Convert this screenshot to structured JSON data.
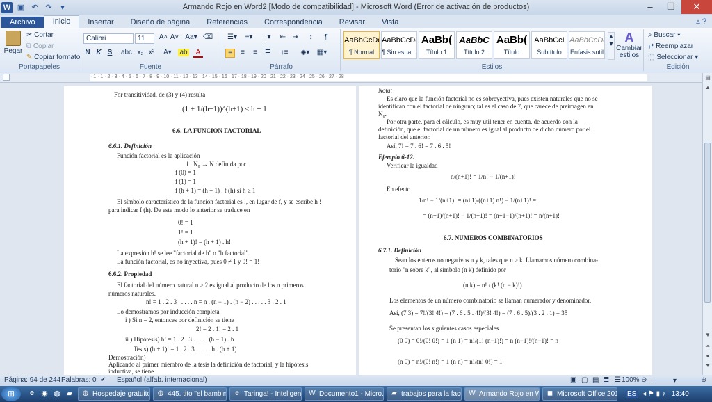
{
  "window": {
    "title": "Armando Rojo en Word2 [Modo de compatibilidad] - Microsoft Word (Error de activación de productos)"
  },
  "qat": {
    "undo": "↶",
    "redo": "↷",
    "logo": "W"
  },
  "tabs": [
    {
      "label": "Archivo"
    },
    {
      "label": "Inicio"
    },
    {
      "label": "Insertar"
    },
    {
      "label": "Diseño de página"
    },
    {
      "label": "Referencias"
    },
    {
      "label": "Correspondencia"
    },
    {
      "label": "Revisar"
    },
    {
      "label": "Vista"
    }
  ],
  "ribbon": {
    "portapapeles": {
      "label": "Portapapeles",
      "pegar": "Pegar",
      "cortar": "Cortar",
      "copiar": "Copiar",
      "copiar_formato": "Copiar formato"
    },
    "fuente": {
      "label": "Fuente",
      "font": "Calibri",
      "size": "11",
      "bold": "N",
      "italic": "K",
      "underline": "S"
    },
    "parrafo": {
      "label": "Párrafo"
    },
    "estilos": {
      "label": "Estilos",
      "items": [
        {
          "sample": "AaBbCcDc",
          "name": "¶ Normal"
        },
        {
          "sample": "AaBbCcDc",
          "name": "¶ Sin espa..."
        },
        {
          "sample": "AaBb(",
          "name": "Título 1"
        },
        {
          "sample": "AaBbC",
          "name": "Título 2"
        },
        {
          "sample": "AaBb(",
          "name": "Título"
        },
        {
          "sample": "AaBbCcI",
          "name": "Subtítulo"
        },
        {
          "sample": "AaBbCcDc",
          "name": "Énfasis sutil"
        }
      ],
      "cambiar": "Cambiar estilos"
    },
    "edicion": {
      "label": "Edición",
      "buscar": "Buscar",
      "reemplazar": "Reemplazar",
      "seleccionar": "Seleccionar"
    }
  },
  "ruler": {
    "numbers": "· 1 · 1 · 2 · 3 · 4 · 5 · 6 · 7 · 8 · 9 · 10 · 11 · 12 · 13 · 14 · 15 · 16 · 17 · 18 · 19 · 20 · 21 · 22 · 23 · 24 · 25 · 26 · 27 · 28"
  },
  "left_page": {
    "l1": "For transitividad, de (3) y (4) resulta",
    "l2": "(1 + 1/(h+1))^(h+1) < h + 1",
    "l3": "6.6.  LA FUNCION FACTORIAL",
    "l4": "6.6.1.  Definición",
    "l5": "Función factorial es la aplicación",
    "l6": "f : N₀ → N  definida por",
    "l7": "f (0) = 1",
    "l8": "f (1) = 1",
    "l9": "f (h + 1) = (h + 1) . f (h)  si h ≥ 1",
    "l10": "El símbolo característico de la función factorial es !, en lugar de f, y se escribe h !",
    "l11": "para indicar f (h). De este modo lo anterior se traduce en",
    "l12": "0! = 1",
    "l13": "1! = 1",
    "l14": "(h + 1)! = (h + 1) . h!",
    "l15": "La expresión h! se lee \"factorial de h\" o \"h factorial\".",
    "l16": "La función factorial, es no inyectiva, pues 0 ≠ 1 y 0! = 1!",
    "l17": "6.6.2.  Propiedad",
    "l18": "El factorial del número natural n ≥ 2 es igual al producto de los n primeros",
    "l19": "números naturales.",
    "l20": "n! = 1 . 2 . 3 . . . . . n = n . (n − 1) . (n − 2) . . . . . 3 . 2 . 1",
    "l21": "Lo demostramos por inducción completa",
    "l22": "i ) Si n = 2, entonces por definición se tiene",
    "l23": "2! = 2 . 1! = 2 . 1",
    "l24": "ii ) Hipótesis)  h! = 1 . 2 . 3 . . . . . (h − 1) . h",
    "l25": "Tesis)  (h + 1)! = 1 . 2 . 3 . . . . . h . (h + 1)",
    "l26": "Demostración)",
    "l27": "Aplicando al primer miembro de la tesis la definición de factorial, y la hipótesis",
    "l28": "inductiva, se tiene"
  },
  "right_page": {
    "r1": "Nota:",
    "r2": "Es claro que la función factorial no es sobreyectiva, pues existen naturales que no se",
    "r3": "identifican con el factorial de ninguno; tal es el caso de 7, que carece de preimagen en",
    "r4": "N₀.",
    "r5": "Por otra parte, para el cálculo, es muy útil tener en cuenta, de acuerdo con la",
    "r6": "definición, que el factorial de un número es igual al producto de dicho número por el",
    "r7": "factorial del anterior.",
    "r8": "Así,  7! = 7 . 6! = 7 . 6 . 5!",
    "r9": "Ejemplo 6-12.",
    "r10": "Verificar la igualdad",
    "r11": "n/(n+1)! = 1/n! − 1/(n+1)!",
    "r12": "En efecto",
    "r13": "1/n! − 1/(n+1)! = (n+1)/((n+1) n!) − 1/(n+1)! =",
    "r14": "= (n+1)/(n+1)! − 1/(n+1)! = (n+1−1)/(n+1)! = n/(n+1)!",
    "r15": "6.7.  NUMEROS COMBINATORIOS",
    "r16": "6.7.1.  Definición",
    "r17": "Sean los enteros no negativos n y k, tales que n ≥ k. Llamamos número combina-",
    "r18": "torio \"n sobre k\", al símbolo (n k) definido por",
    "r19": "(n k) = n! / (k! (n − k)!)",
    "r20": "Los elementos de un número combinatorio se llaman numerador y denominador.",
    "r21": "Así,  (7 3) = 7!/(3! 4!) = (7 . 6 . 5 . 4!)/(3! 4!) = (7 . 6 . 5)/(3 . 2 . 1) = 35",
    "r22": "Se presentan los siguientes casos especiales.",
    "r23": "(0 0) = 0!/(0! 0!) = 1        (n 1) = n!/(1! (n−1)!) = n (n−1)!/(n−1)! = n",
    "r24": "(n 0) = n!/(0! n!) = 1        (n n) = n!/(n! 0!) = 1"
  },
  "status": {
    "page": "Página: 94 de 244",
    "words": "Palabras: 0",
    "lang": "Español (alfab. internacional)",
    "zoom": "100%"
  },
  "taskbar": {
    "tasks": [
      {
        "label": "Hospedaje gratuito ..."
      },
      {
        "label": "445. tito \"el bambin..."
      },
      {
        "label": "Taringa! - Inteligen..."
      },
      {
        "label": "Documento1 - Micro..."
      },
      {
        "label": "trabajos para la facu"
      },
      {
        "label": "Armando Rojo en W..."
      },
      {
        "label": "Microsoft Office 2010"
      }
    ],
    "lang": "ES",
    "clock": "13:40"
  }
}
